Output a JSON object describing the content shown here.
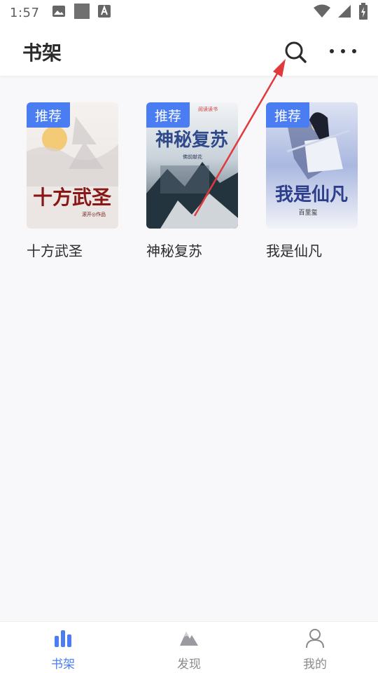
{
  "status_bar": {
    "time": "1:57",
    "icons": [
      "image-icon",
      "square-icon",
      "text-a-icon"
    ],
    "right_icons": [
      "wifi-icon",
      "signal-icon",
      "battery-charging-icon"
    ]
  },
  "header": {
    "title": "书架",
    "search_icon": "search-icon",
    "more_icon": "more-horizontal-icon"
  },
  "colors": {
    "accent": "#4a7cf2",
    "annotation": "#e0393e",
    "background": "#f8f8fb",
    "text": "#2b2b2b",
    "muted": "#8a8a8e"
  },
  "books": [
    {
      "title": "十方武圣",
      "badge": "推荐",
      "cover_text": "十方武圣",
      "cover_subtitle": "滚开◎作品"
    },
    {
      "title": "神秘复苏",
      "badge": "推荐",
      "cover_text": "神秘复苏",
      "cover_subtitle": "佛前献花",
      "cover_top": "阅读读书"
    },
    {
      "title": "我是仙凡",
      "badge": "推荐",
      "cover_text": "我是仙凡",
      "cover_subtitle": "百里玺"
    }
  ],
  "bottom_nav": [
    {
      "label": "书架",
      "icon": "bookshelf-icon",
      "active": true
    },
    {
      "label": "发现",
      "icon": "mountain-icon",
      "active": false
    },
    {
      "label": "我的",
      "icon": "user-icon",
      "active": false
    }
  ]
}
